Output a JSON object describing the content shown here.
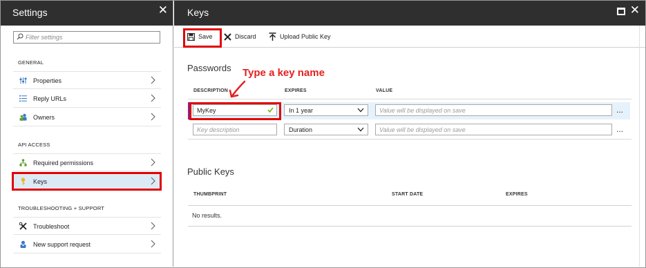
{
  "settings": {
    "title": "Settings",
    "close_glyph": "✕",
    "filter_placeholder": "Filter settings",
    "sections": {
      "general": "GENERAL",
      "api_access": "API ACCESS",
      "troubleshooting": "TROUBLESHOOTING + SUPPORT"
    },
    "items": [
      {
        "label": "Properties",
        "icon": "properties-icon"
      },
      {
        "label": "Reply URLs",
        "icon": "list-icon"
      },
      {
        "label": "Owners",
        "icon": "owners-icon"
      },
      {
        "label": "Required permissions",
        "icon": "permissions-icon"
      },
      {
        "label": "Keys",
        "icon": "key-icon",
        "active": true
      },
      {
        "label": "Troubleshoot",
        "icon": "troubleshoot-icon"
      },
      {
        "label": "New support request",
        "icon": "support-icon"
      }
    ]
  },
  "keys": {
    "title": "Keys",
    "close_glyph": "✕",
    "toolbar": {
      "save": "Save",
      "discard": "Discard",
      "upload": "Upload Public Key"
    },
    "passwords": {
      "heading": "Passwords",
      "col_description": "DESCRIPTION",
      "col_expires": "EXPIRES",
      "col_value": "VALUE",
      "rows": [
        {
          "description": "MyKey",
          "description_placeholder": "",
          "expires": "In 1 year",
          "value_placeholder": "Value will be displayed on save"
        },
        {
          "description": "",
          "description_placeholder": "Key description",
          "expires": "Duration",
          "value_placeholder": "Value will be displayed on save"
        }
      ],
      "more_glyph": "..."
    },
    "public_keys": {
      "heading": "Public Keys",
      "col_thumbprint": "THUMBPRINT",
      "col_start_date": "START DATE",
      "col_expires": "EXPIRES",
      "empty_text": "No results."
    }
  },
  "annotation": {
    "text": "Type a key name",
    "color": "#e52020"
  },
  "colors": {
    "header_bg": "#2f2f2f",
    "active_item_bg": "#dceaf6",
    "highlight_box": "#e00000",
    "valid_check": "#6bb300"
  }
}
